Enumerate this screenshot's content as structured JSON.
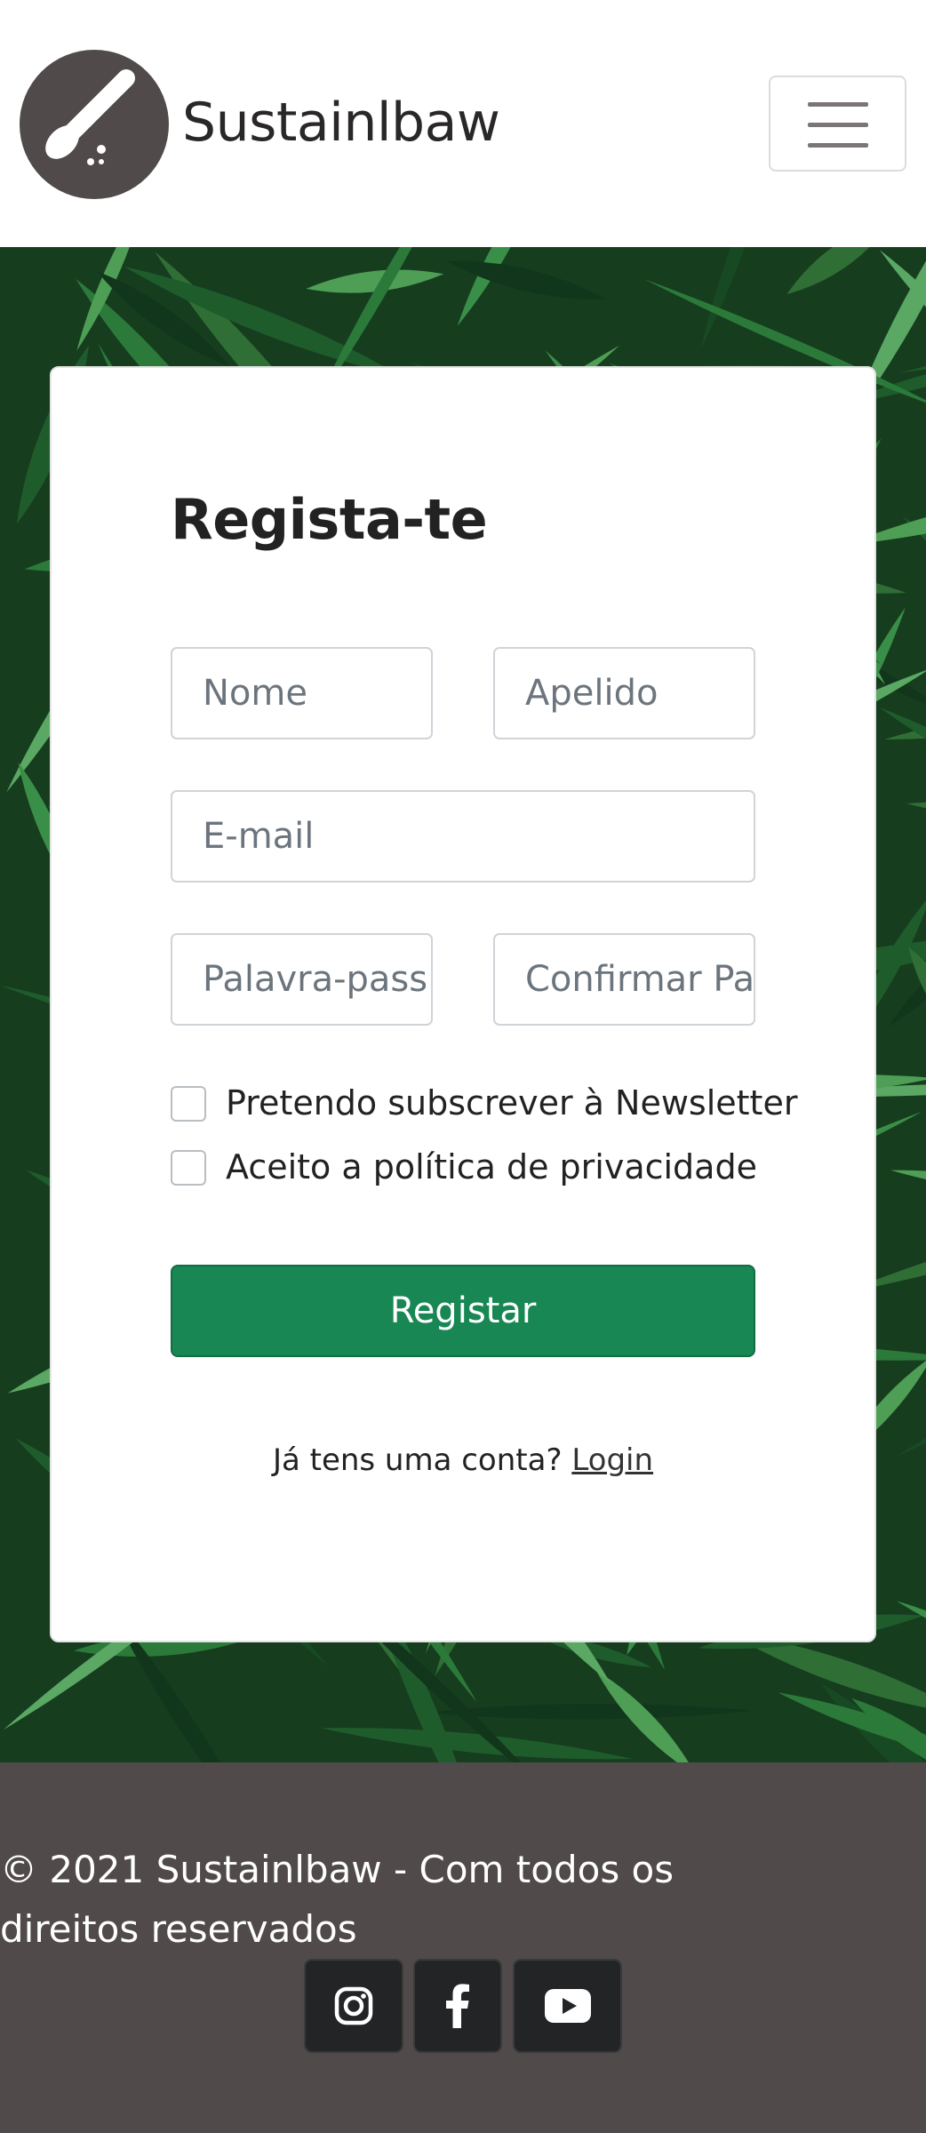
{
  "navbar": {
    "brand_name": "Sustainlbaw",
    "logo_icon": "spoon-icon",
    "menu_icon": "hamburger-menu-icon"
  },
  "form": {
    "title": "Regista-te",
    "first_name_placeholder": "Nome",
    "last_name_placeholder": "Apelido",
    "email_placeholder": "E-mail",
    "password_placeholder": "Palavra-pass",
    "confirm_password_placeholder": "Confirmar Pa",
    "newsletter_label": "Pretendo subscrever à Newsletter",
    "privacy_label": "Aceito a política de privacidade",
    "submit_label": "Registar",
    "login_prompt": "Já tens uma conta?",
    "login_link": "Login"
  },
  "footer": {
    "copyright": "© 2021 Sustainlbaw - Com todos os direitos reservados",
    "social": [
      "instagram-icon",
      "facebook-icon",
      "youtube-icon"
    ]
  },
  "colors": {
    "brand": "#504a4a",
    "primary_button": "#198754",
    "background_leaves": "#173d1f"
  }
}
